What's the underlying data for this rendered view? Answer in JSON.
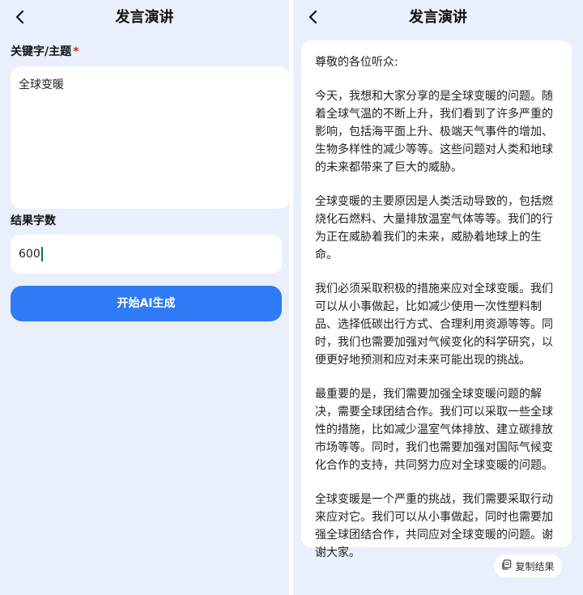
{
  "left": {
    "title": "发言演讲",
    "keyword_label": "关键字/主题",
    "required_mark": "*",
    "keyword_value": "全球变暖",
    "count_label": "结果字数",
    "count_value": "600",
    "generate_button": "开始AI生成"
  },
  "right": {
    "title": "发言演讲",
    "paragraphs": [
      "尊敬的各位听众:",
      "今天，我想和大家分享的是全球变暖的问题。随着全球气温的不断上升，我们看到了许多严重的影响，包括海平面上升、极端天气事件的增加、生物多样性的减少等等。这些问题对人类和地球的未来都带来了巨大的威胁。",
      "全球变暖的主要原因是人类活动导致的，包括燃烧化石燃料、大量排放温室气体等等。我们的行为正在威胁着我们的未来，威胁着地球上的生命。",
      "我们必须采取积极的措施来应对全球变暖。我们可以从小事做起，比如减少使用一次性塑料制品、选择低碳出行方式、合理利用资源等等。同时，我们也需要加强对气候变化的科学研究，以便更好地预测和应对未来可能出现的挑战。",
      "最重要的是，我们需要加强全球变暖问题的解决，需要全球团结合作。我们可以采取一些全球性的措施，比如减少温室气体排放、建立碳排放市场等等。同时，我们也需要加强对国际气候变化合作的支持，共同努力应对全球变暖的问题。",
      "全球变暖是一个严重的挑战，我们需要采取行动来应对它。我们可以从小事做起，同时也需要加强全球团结合作，共同应对全球变暖的问题。谢谢大家。"
    ],
    "copy_button": "复制结果"
  },
  "icons": {
    "back": "chevron-left-icon",
    "copy": "copy-icon"
  },
  "colors": {
    "background": "#eaf0fb",
    "accent": "#2f7bf6",
    "required": "#e02020"
  }
}
